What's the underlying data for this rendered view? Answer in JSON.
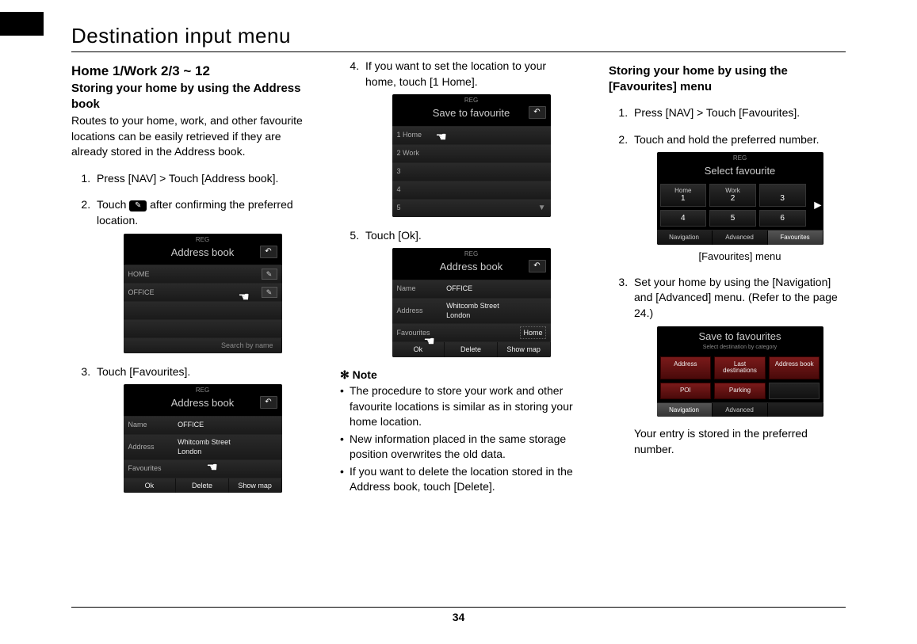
{
  "page_number": "34",
  "header": "Destination input menu",
  "col1": {
    "heading": "Home 1/Work 2/3 ~ 12",
    "subheading": "Storing your home by using the Address book",
    "intro": "Routes to your home, work, and other favourite locations can be easily retrieved if they are already stored in the Address book.",
    "step1": "Press [NAV] > Touch [Address book].",
    "step2_pre": "Touch ",
    "step2_post": " after confirming the preferred location.",
    "step3": "Touch [Favourites].",
    "shots": {
      "reg": "REG",
      "title_addrbook": "Address book",
      "home_row": "HOME",
      "office_row": "OFFICE",
      "search_by_name": "Search by name",
      "name_label": "Name",
      "name_value": "OFFICE",
      "address_label": "Address",
      "address_value": "Whitcomb Street\nLondon",
      "favourites_label": "Favourites",
      "ok_btn": "Ok",
      "delete_btn": "Delete",
      "showmap_btn": "Show map"
    }
  },
  "col2": {
    "step4": "If you want to set the location to your home, touch [1 Home].",
    "step5": "Touch [Ok].",
    "shot_save": {
      "reg": "REG",
      "title": "Save to favourite",
      "rows": [
        "1 Home",
        "2 Work",
        "3",
        "4",
        "5"
      ]
    },
    "shot_book": {
      "reg": "REG",
      "title": "Address book",
      "name_label": "Name",
      "name_value": "OFFICE",
      "address_label": "Address",
      "address_value": "Whitcomb Street\nLondon",
      "favourites_label": "Favourites",
      "favourites_value": "Home",
      "ok_btn": "Ok",
      "delete_btn": "Delete",
      "showmap_btn": "Show map"
    },
    "note_heading": "✻ Note",
    "note1": "The procedure to store your work and other favourite locations is similar as in storing your home location.",
    "note2": "New information placed in the same storage position overwrites the old data.",
    "note3": "If you want to delete the location stored in the Address book, touch [Delete]."
  },
  "col3": {
    "subheading": "Storing your home by using the [Favourites] menu",
    "step1": "Press [NAV] > Touch [Favourites].",
    "step2": "Touch and hold the preferred number.",
    "caption": "[Favourites] menu",
    "step3": "Set your home by using the [Navigation] and [Advanced] menu. (Refer to the page 24.)",
    "final": "Your entry is stored in the preferred number.",
    "shot_fav": {
      "reg": "REG",
      "title": "Select favourite",
      "cell1_top": "Home",
      "cell1_num": "1",
      "cell2_top": "Work",
      "cell2_num": "2",
      "cell3_num": "3",
      "cell4_num": "4",
      "cell5_num": "5",
      "cell6_num": "6",
      "tab_nav": "Navigation",
      "tab_adv": "Advanced",
      "tab_fav": "Favourites"
    },
    "shot_save": {
      "title": "Save to favourites",
      "subtitle": "Select destination by category",
      "c1": "Address",
      "c2": "Last destinations",
      "c3": "Address book",
      "c4": "POI",
      "c5": "Parking",
      "c6": "",
      "tab_nav": "Navigation",
      "tab_adv": "Advanced",
      "tab_fav": ""
    }
  }
}
